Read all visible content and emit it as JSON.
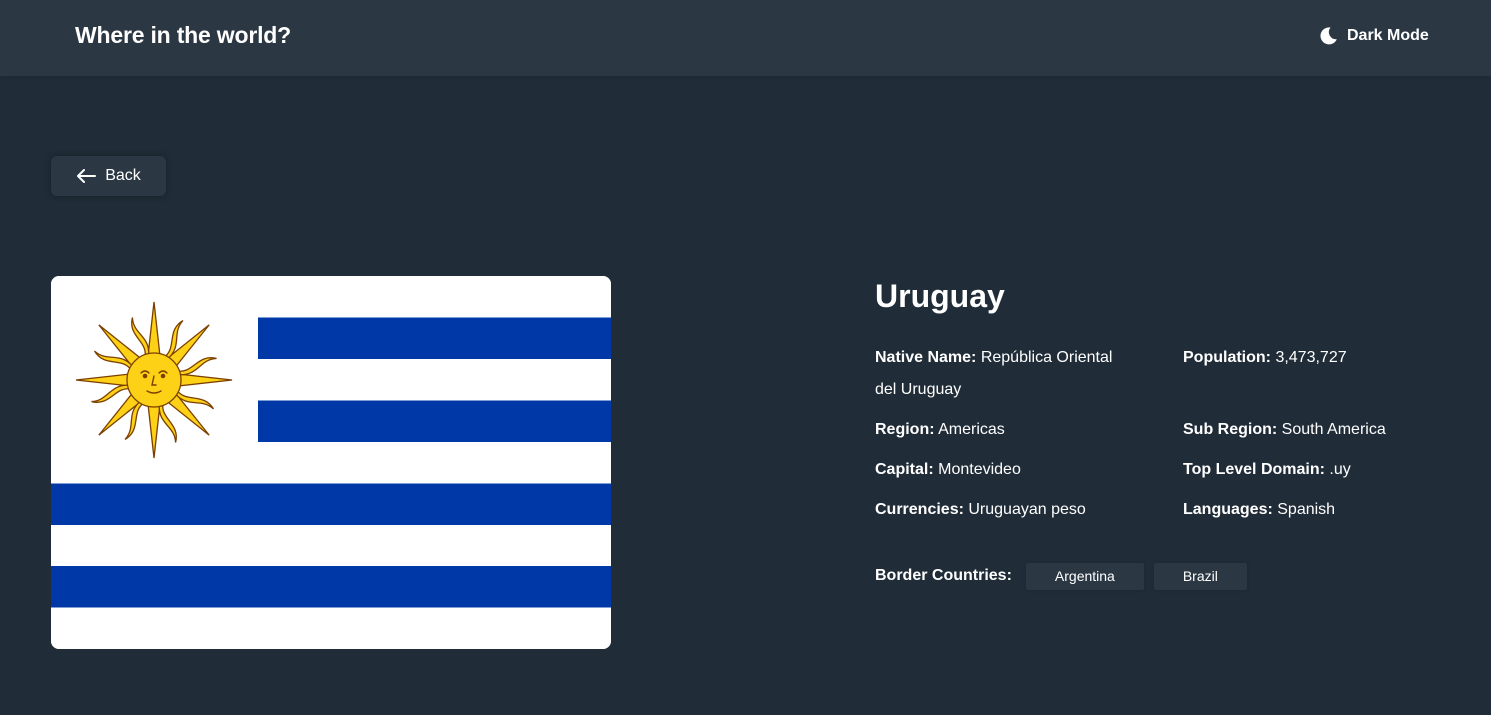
{
  "header": {
    "title": "Where in the world?",
    "theme_toggle_label": "Dark Mode",
    "theme_icon": "moon-icon"
  },
  "back_button": {
    "label": "Back",
    "icon": "arrow-left-icon"
  },
  "flag": {
    "alt": "Flag of Uruguay",
    "colors": {
      "blue": "#0038a8",
      "white": "#ffffff",
      "sun_yellow": "#fcd116",
      "sun_brown": "#7b3f00"
    }
  },
  "country": {
    "name": "Uruguay",
    "native_name_label": "Native Name:",
    "native_name": "República Oriental del Uruguay",
    "population_label": "Population:",
    "population": "3,473,727",
    "region_label": "Region:",
    "region": "Americas",
    "sub_region_label": "Sub Region:",
    "sub_region": "South America",
    "capital_label": "Capital:",
    "capital": "Montevideo",
    "tld_label": "Top Level Domain:",
    "tld": ".uy",
    "currencies_label": "Currencies:",
    "currencies": "Uruguayan peso",
    "languages_label": "Languages:",
    "languages": "Spanish"
  },
  "border_countries": {
    "label": "Border Countries:",
    "items": [
      "Argentina",
      "Brazil"
    ]
  },
  "colors": {
    "background": "#202c37",
    "elements": "#2b3844",
    "text": "#ffffff"
  }
}
